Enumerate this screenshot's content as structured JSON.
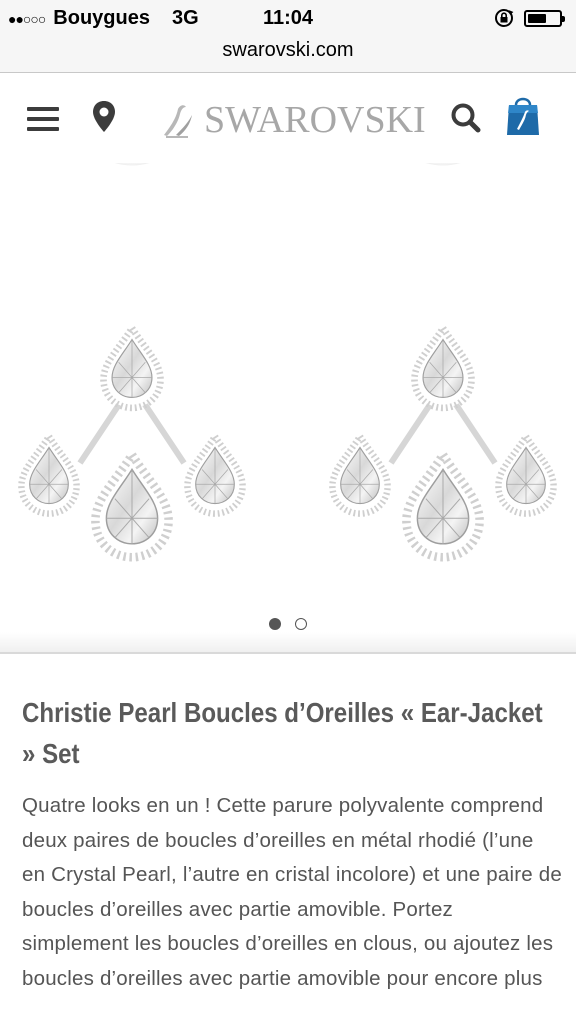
{
  "status_bar": {
    "signal": "●●○○○",
    "carrier": "Bouygues",
    "network": "3G",
    "time": "11:04",
    "battery_level": 0.6
  },
  "browser": {
    "url": "swarovski.com"
  },
  "header": {
    "logo_text": "SWAROVSKI",
    "icons": [
      "menu-icon",
      "location-pin-icon",
      "swan-logo-icon",
      "search-icon",
      "shopping-bag-icon"
    ],
    "bag_color": "#1e6aa8"
  },
  "gallery": {
    "page_count": 2,
    "current_page": 1
  },
  "product": {
    "title": "Christie Pearl Boucles d’Oreilles « Ear-Jacket » Set",
    "description": "Quatre looks en un ! Cette parure polyvalente comprend deux paires de boucles d’oreilles en métal rhodié (l’une en Crystal Pearl, l’autre en cristal incolore) et une paire de boucles d’oreilles avec partie amovible. Portez simplement les boucles d’oreilles en clous, ou ajoutez les boucles d’oreilles avec partie amovible pour encore plus"
  }
}
